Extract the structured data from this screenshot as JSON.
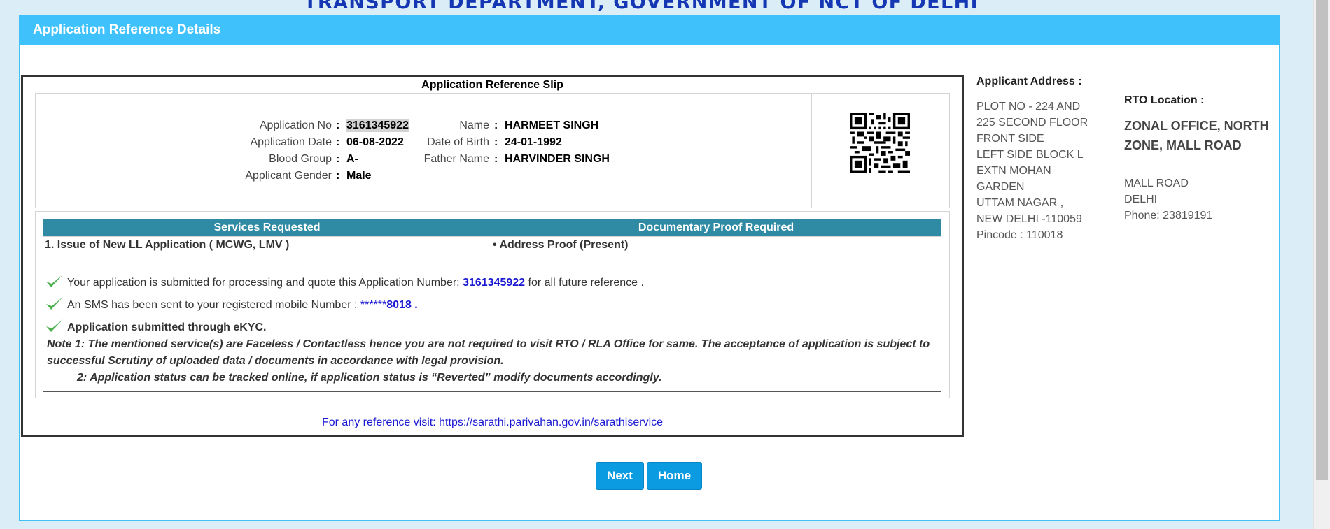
{
  "header": {
    "department": "TRANSPORT DEPARTMENT, GOVERNMENT OF NCT OF DELHI"
  },
  "panel": {
    "title": "Application Reference Details"
  },
  "slip": {
    "title": "Application Reference Slip",
    "colon": ":",
    "fields": {
      "application_no": {
        "label": "Application No",
        "value": "3161345922"
      },
      "application_date": {
        "label": "Application Date",
        "value": "06-08-2022"
      },
      "blood_group": {
        "label": "Blood Group",
        "value": "A-"
      },
      "gender": {
        "label": "Applicant Gender",
        "value": "Male"
      },
      "name": {
        "label": "Name",
        "value": "HARMEET SINGH"
      },
      "dob": {
        "label": "Date of Birth",
        "value": "24-01-1992"
      },
      "father_name": {
        "label": "Father Name",
        "value": "HARVINDER SINGH"
      }
    },
    "services_table": {
      "headers": [
        "Services Requested",
        "Documentary Proof Required"
      ],
      "rows": [
        [
          "1. Issue of New LL Application ( MCWG, LMV )",
          "• Address Proof (Present)"
        ]
      ]
    },
    "messages": {
      "submitted_pre": "Your application is submitted for processing and quote this Application Number:",
      "submitted_number": "3161345922",
      "submitted_post": "for all future reference .",
      "sms_pre": "An SMS has been sent to your registered mobile Number :",
      "sms_mask": "******",
      "sms_number": "8018",
      "sms_post": ".",
      "ekyc": "Application submitted through eKYC."
    },
    "notes": {
      "note1": "Note 1:  The mentioned service(s) are Faceless / Contactless hence you are not required to visit RTO / RLA Office for same. The acceptance of application is subject to successful Scrutiny of uploaded data / documents in accordance with legal provision.",
      "note2": "2:  Application status can be tracked online, if application status is “Reverted” modify documents accordingly."
    },
    "reference": {
      "prefix": "For any reference visit:",
      "url": "https://sarathi.parivahan.gov.in/sarathiservice"
    }
  },
  "applicant_address": {
    "title": "Applicant Address :",
    "lines": [
      "PLOT NO - 224 AND",
      "225 SECOND FLOOR",
      "FRONT SIDE",
      "LEFT SIDE BLOCK L",
      "EXTN MOHAN",
      "GARDEN",
      "UTTAM NAGAR ,",
      "NEW DELHI -110059",
      "Pincode : 110018"
    ]
  },
  "rto_location": {
    "title": "RTO Location :",
    "office": "ZONAL OFFICE, NORTH ZONE, MALL ROAD",
    "lines": [
      "MALL ROAD",
      "DELHI",
      "Phone:  23819191"
    ]
  },
  "buttons": {
    "next": "Next",
    "home": "Home"
  },
  "colors": {
    "accent": "#3fc1fb",
    "table_header": "#2f8aa3",
    "button": "#0b9be0",
    "link": "#1a18d1"
  }
}
